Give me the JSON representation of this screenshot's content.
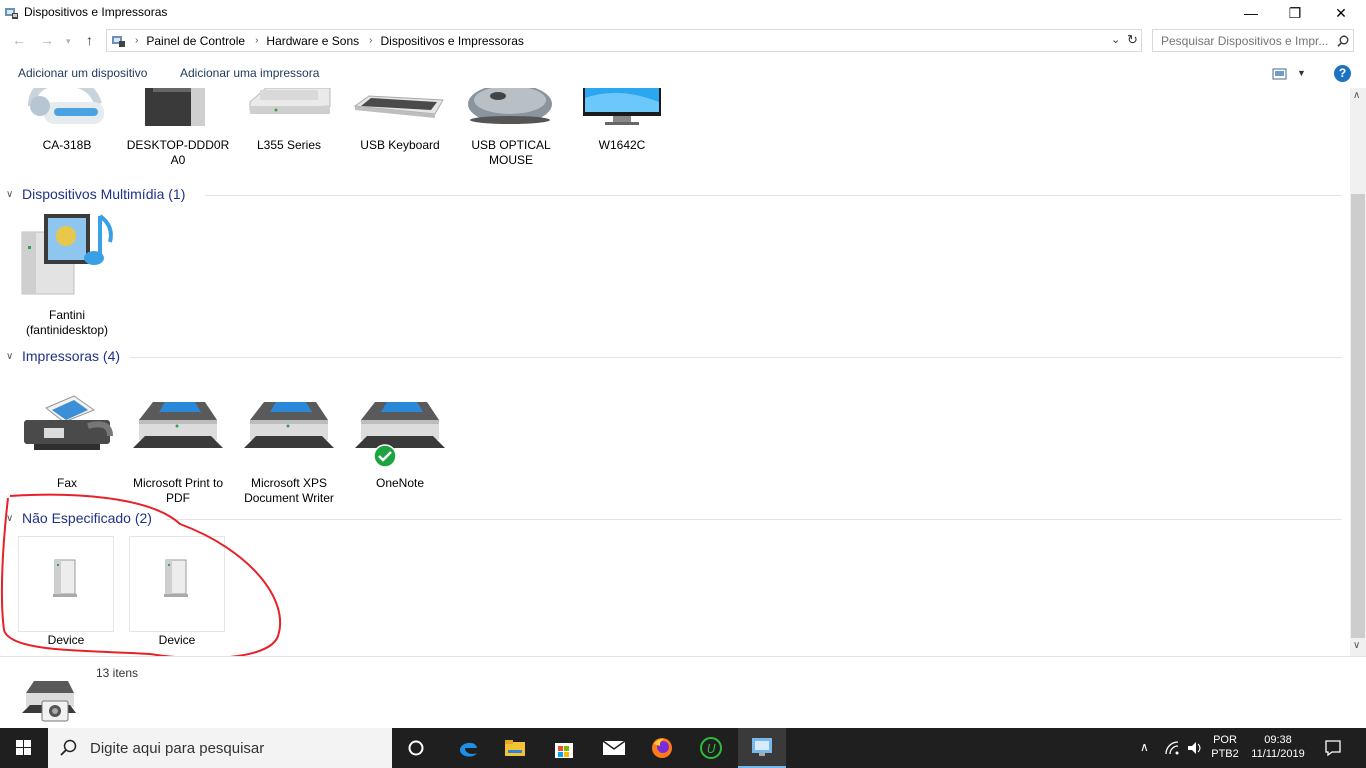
{
  "window": {
    "title": "Dispositivos e Impressoras",
    "controls": {
      "minimize": "—",
      "maximize": "❐",
      "close": "✕"
    }
  },
  "address": {
    "breadcrumbs": [
      "Painel de Controle",
      "Hardware e Sons",
      "Dispositivos e Impressoras"
    ],
    "search_placeholder": "Pesquisar Dispositivos e Impr..."
  },
  "commandbar": {
    "add_device": "Adicionar um dispositivo",
    "add_printer": "Adicionar uma impressora",
    "help": "?"
  },
  "devices_top": [
    {
      "label": "CA-318B",
      "icon": "headset-icon"
    },
    {
      "label": "DESKTOP-DDD0R A0",
      "icon": "computer-tower-icon"
    },
    {
      "label": "L355 Series",
      "icon": "scanner-icon"
    },
    {
      "label": "USB Keyboard",
      "icon": "keyboard-icon"
    },
    {
      "label": "USB OPTICAL MOUSE",
      "icon": "mouse-icon"
    },
    {
      "label": "W1642C",
      "icon": "monitor-icon"
    }
  ],
  "groups": {
    "multimedia": {
      "title": "Dispositivos Multimídia (1)",
      "items": [
        {
          "label": "Fantini (fantinidesktop)",
          "icon": "media-server-icon"
        }
      ]
    },
    "printers": {
      "title": "Impressoras (4)",
      "items": [
        {
          "label": "Fax",
          "icon": "fax-icon"
        },
        {
          "label": "Microsoft Print to PDF",
          "icon": "printer-icon"
        },
        {
          "label": "Microsoft XPS Document Writer",
          "icon": "printer-icon"
        },
        {
          "label": "OneNote",
          "icon": "printer-default-icon"
        }
      ]
    },
    "unspecified": {
      "title": "Não Especificado (2)",
      "items": [
        {
          "label": "Device",
          "icon": "generic-device-icon"
        },
        {
          "label": "Device",
          "icon": "generic-device-icon"
        }
      ]
    }
  },
  "details": {
    "count": "13 itens"
  },
  "taskbar": {
    "search_placeholder": "Digite aqui para pesquisar",
    "lang_top": "POR",
    "lang_bottom": "PTB2",
    "time": "09:38",
    "date": "11/11/2019"
  },
  "colors": {
    "accent": "#1e3287",
    "taskbar": "#1f1f1f",
    "annotation": "#e8202a",
    "check": "#1ea341"
  }
}
